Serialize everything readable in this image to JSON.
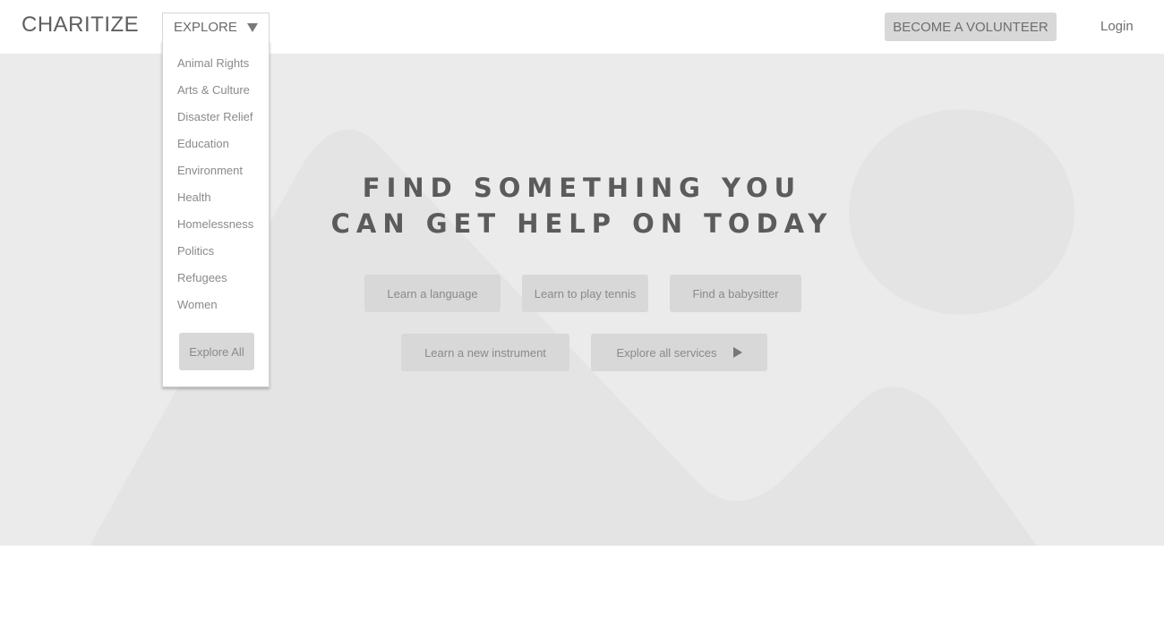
{
  "header": {
    "logo": "CHARITIZE",
    "explore_label": "EXPLORE",
    "volunteer_label": "BECOME A VOLUNTEER",
    "login_label": "Login"
  },
  "explore_menu": {
    "items": [
      {
        "label": "Animal Rights"
      },
      {
        "label": "Arts & Culture"
      },
      {
        "label": "Disaster Relief"
      },
      {
        "label": "Education"
      },
      {
        "label": "Environment"
      },
      {
        "label": "Health"
      },
      {
        "label": "Homelessness"
      },
      {
        "label": "Politics"
      },
      {
        "label": "Refugees"
      },
      {
        "label": "Women"
      }
    ],
    "explore_all_label": "Explore All"
  },
  "hero": {
    "title_line1": "FIND SOMETHING YOU",
    "title_line2": "CAN GET HELP ON TODAY",
    "buttons": [
      {
        "label": "Learn a language"
      },
      {
        "label": "Learn to play tennis"
      },
      {
        "label": "Find a babysitter"
      },
      {
        "label": "Learn a new instrument"
      },
      {
        "label": "Explore all services"
      }
    ]
  },
  "icons": {
    "dropdown_caret": "caret-down-icon",
    "explore_services_arrow": "play-icon",
    "hero_placeholder": "image-placeholder-icon"
  },
  "colors": {
    "button_bg": "#d8d8d9",
    "hero_bg": "#ebebec",
    "title_text": "#5b5b5c"
  }
}
